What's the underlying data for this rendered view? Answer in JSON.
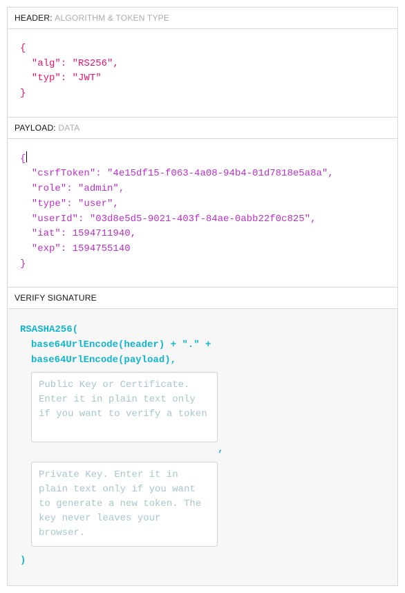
{
  "sections": {
    "header": {
      "label": "HEADER:",
      "sub": "ALGORITHM & TOKEN TYPE"
    },
    "payload": {
      "label": "PAYLOAD:",
      "sub": "DATA"
    },
    "signature": {
      "label": "VERIFY SIGNATURE"
    }
  },
  "header_json": {
    "line1": "{",
    "line2": "  \"alg\": \"RS256\",",
    "line3": "  \"typ\": \"JWT\"",
    "line4": "}"
  },
  "payload_json": {
    "line1": "{",
    "line2": "  \"csrfToken\": \"4e15df15-f063-4a08-94b4-01d7818e5a8a\",",
    "line3": "  \"role\": \"admin\",",
    "line4": "  \"type\": \"user\",",
    "line5": "  \"userId\": \"03d8e5d5-9021-403f-84ae-0abb22f0c825\",",
    "line6": "  \"iat\": 1594711940,",
    "line7": "  \"exp\": 1594755140",
    "line8": "}"
  },
  "signature_block": {
    "fn_open": "RSASHA256(",
    "arg1": "base64UrlEncode(header) + \".\" +",
    "arg2": "base64UrlEncode(payload),",
    "comma": ",",
    "fn_close": ")",
    "public_key_placeholder": "Public Key or Certificate. Enter it in plain text only if you want to verify a token",
    "private_key_placeholder": "Private Key. Enter it in plain text only if you want to generate a new token. The key never leaves your browser."
  }
}
